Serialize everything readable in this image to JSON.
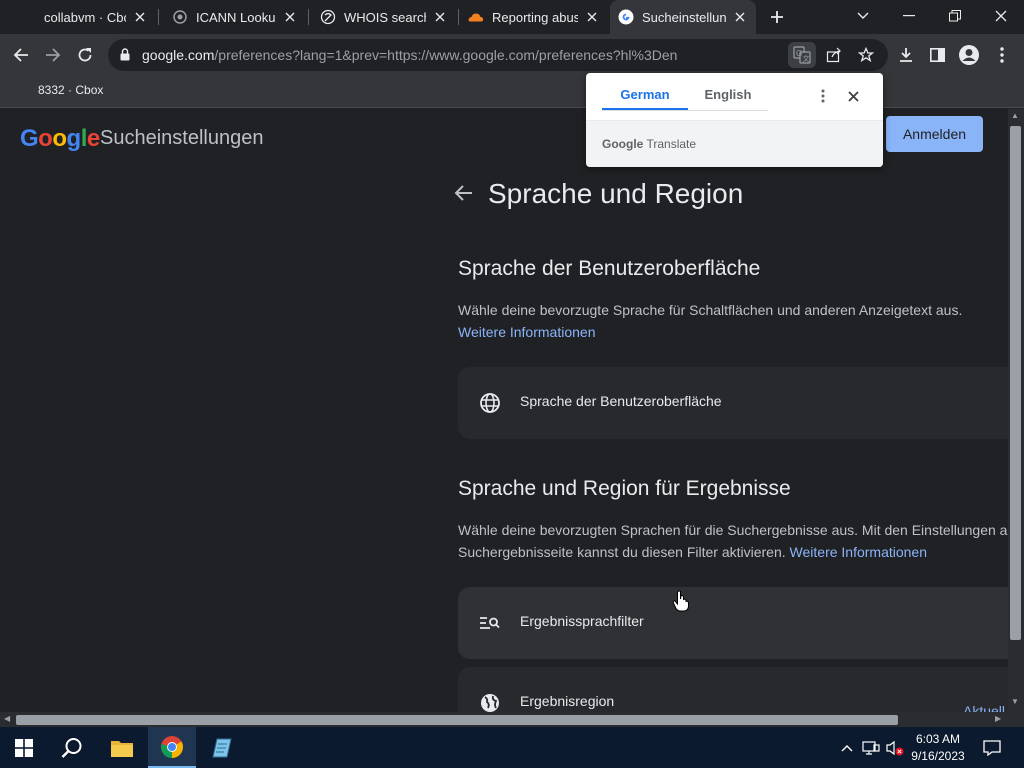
{
  "tabs": [
    {
      "title": "collabvm · Cbox"
    },
    {
      "title": "ICANN Lookup"
    },
    {
      "title": "WHOIS search r"
    },
    {
      "title": "Reporting abuse"
    },
    {
      "title": "Sucheinstellunge"
    }
  ],
  "address_bar": {
    "host": "google.com",
    "path": "/preferences?lang=1&prev=https://www.google.com/preferences?hl%3Den"
  },
  "bookmarks": [
    {
      "label": "8332 · Cbox"
    }
  ],
  "translate_popup": {
    "tab_source": "German",
    "tab_target": "English",
    "brand_google": "Google",
    "brand_product": "Translate"
  },
  "page": {
    "logo_text": "Google",
    "settings_title": "Sucheinstellungen",
    "signin_label": "Anmelden",
    "title": "Sprache und Region",
    "section_ui": {
      "heading": "Sprache der Benutzeroberfläche",
      "description": "Wähle deine bevorzugte Sprache für Schaltflächen und anderen Anzeigetext aus.",
      "link": "Weitere Informationen",
      "card_label": "Sprache der Benutzeroberfläche"
    },
    "section_results": {
      "heading": "Sprache und Region für Ergebnisse",
      "description_line1": "Wähle deine bevorzugten Sprachen für die Suchergebnisse aus. Mit den Einstellungen a",
      "description_line2": "Suchergebnisseite kannst du diesen Filter aktivieren.",
      "link": "Weitere Informationen",
      "card_filter_label": "Ergebnissprachfilter",
      "card_region_label": "Ergebnisregion",
      "card_region_value": "Aktuell"
    }
  },
  "taskbar": {
    "time": "6:03 AM",
    "date": "9/16/2023"
  },
  "colors": {
    "accent": "#8ab4f8",
    "page_bg": "#202124",
    "taskbar_bg": "#0b1a2e"
  },
  "icons": [
    "back-icon",
    "forward-icon",
    "reload-icon",
    "lock-icon",
    "translate-icon",
    "share-icon",
    "star-icon",
    "download-icon",
    "sidepanel-icon",
    "profile-icon",
    "menu-icon",
    "globe-icon",
    "filter-search-icon"
  ]
}
